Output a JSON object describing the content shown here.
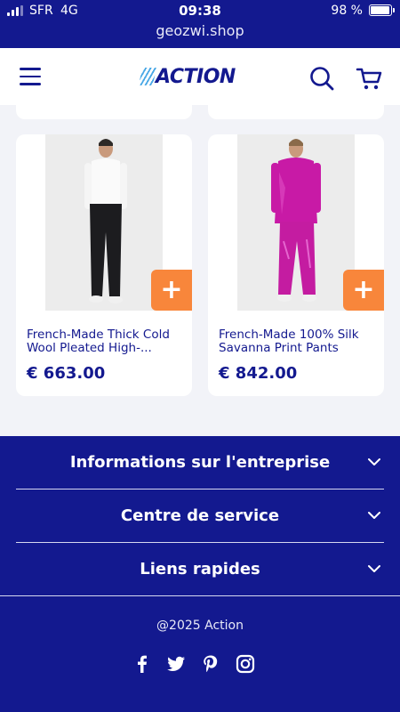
{
  "status_bar": {
    "carrier": "SFR",
    "network": "4G",
    "time": "09:38",
    "battery": "98 %",
    "battery_level": 0.98
  },
  "url_bar": {
    "url": "geozwi.shop"
  },
  "header": {
    "brand": "ACTION",
    "icons": [
      "menu-icon",
      "search-icon",
      "cart-icon"
    ]
  },
  "products": [
    {
      "title": "French-Made Thick Cold Wool Pleated High-...",
      "price": "€ 663.00",
      "add_label": "+"
    },
    {
      "title": "French-Made 100% Silk Savanna Print Pants",
      "price": "€ 842.00",
      "add_label": "+"
    }
  ],
  "footer": {
    "sections": [
      {
        "label": "Informations sur l'entreprise"
      },
      {
        "label": "Centre de service"
      },
      {
        "label": "Liens rapides"
      }
    ],
    "copyright": "@2025 Action",
    "social_icons": [
      "facebook-icon",
      "twitter-icon",
      "pinterest-icon",
      "instagram-icon"
    ]
  },
  "colors": {
    "brand_navy": "#13198f",
    "accent_orange": "#f8863b",
    "logo_stripes": "#4aa8e6",
    "page_bg": "#f2f3f8"
  }
}
